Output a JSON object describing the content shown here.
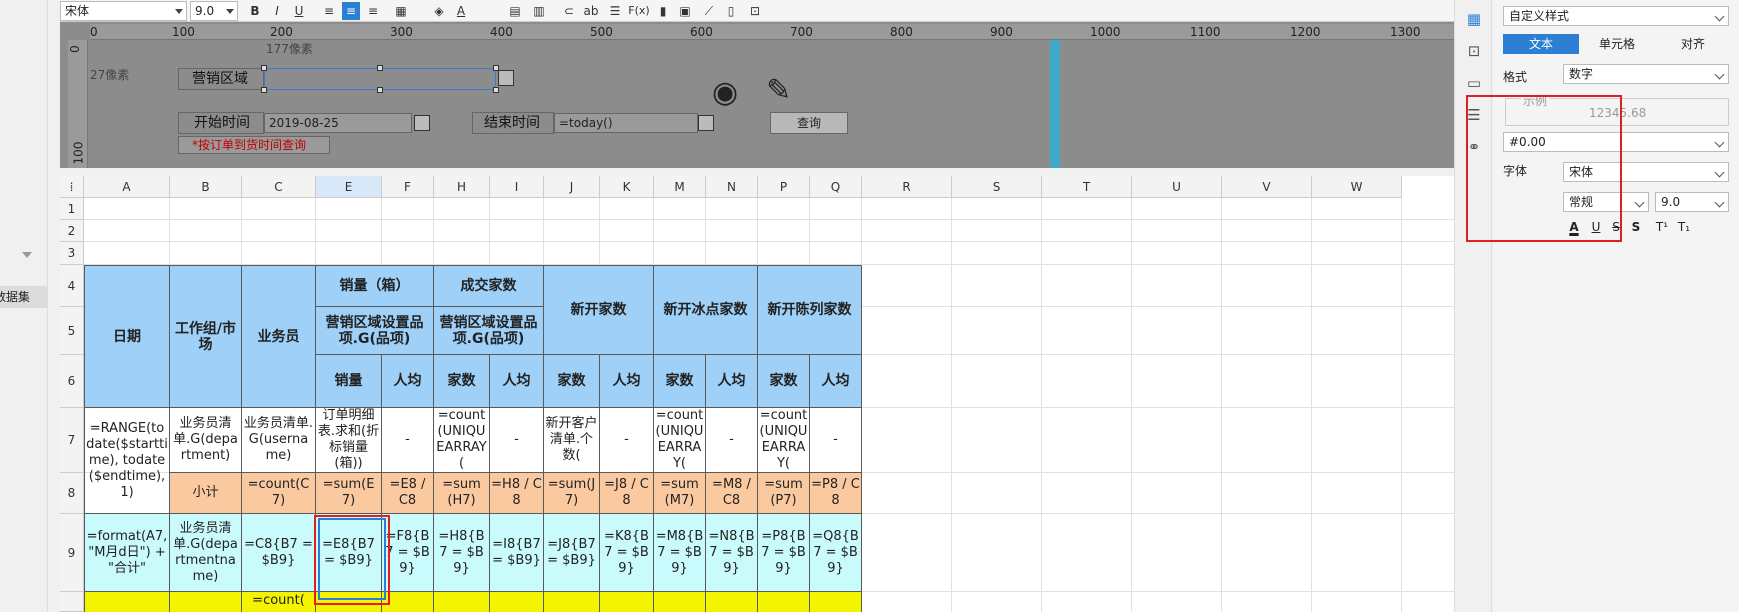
{
  "toolbar": {
    "font": "宋体",
    "size": "9.0",
    "bold": "B",
    "italic": "I",
    "underline": "U",
    "abc": "ab",
    "fx": "F(x)"
  },
  "designer": {
    "ruler_marks": [
      "0",
      "100",
      "200",
      "300",
      "400",
      "500",
      "600",
      "700",
      "800",
      "900",
      "1000",
      "1100",
      "1200",
      "1300"
    ],
    "vruler_marks": [
      "0",
      "100"
    ],
    "width_hint": "177像素",
    "height_hint": "27像素",
    "region_label": "营销区域",
    "start_label": "开始时间",
    "start_value": "2019-08-25",
    "end_label": "结束时间",
    "end_value": "=today()",
    "query_button": "查询",
    "hint_text": "*按订单到货时间查询"
  },
  "grid": {
    "columns": [
      "A",
      "B",
      "C",
      "E",
      "F",
      "H",
      "I",
      "J",
      "K",
      "M",
      "N",
      "P",
      "Q",
      "R",
      "S",
      "T",
      "U",
      "V",
      "W"
    ],
    "rows": [
      "1",
      "2",
      "3",
      "4",
      "5",
      "6",
      "7",
      "8",
      "9"
    ],
    "header": {
      "date": "日期",
      "group": "工作组/市场",
      "salesman": "业务员",
      "volume": "销量（箱）",
      "deal": "成交家数",
      "new": "新开家数",
      "newfrozen": "新开冰点家数",
      "newdisplay": "新开陈列家数",
      "volume_sub": "营销区域设置品项.G(品项)",
      "deal_sub": "营销区域设置品项.G(品项)",
      "xl": "销量",
      "rj": "人均",
      "js": "家数"
    },
    "row7": {
      "a": "=RANGE(todate($starttime), todate($endtime), 1)",
      "b": "业务员清单.G(department)",
      "c": "业务员清单.G(username)",
      "e": "订单明细表.求和(折标销量(箱))",
      "f": "-",
      "h": "=count(UNIQUEARRAY(",
      "i": "-",
      "j": "新开客户清单.个数(",
      "k": "-",
      "m": "=count(UNIQUEARRAY(",
      "n": "-",
      "p": "=count(UNIQUEARRAY(",
      "q": "-"
    },
    "row8": {
      "b": "小计",
      "c": "=count(C7)",
      "e": "=sum(E7)",
      "f": "=E8 / C8",
      "h": "=sum(H7)",
      "i": "=H8 / C8",
      "j": "=sum(J7)",
      "k": "=J8 / C8",
      "m": "=sum(M7)",
      "n": "=M8 / C8",
      "p": "=sum(P7)",
      "q": "=P8 / C8"
    },
    "row9": {
      "a": "=format(A7, \"M月d日\") + \"合计\"",
      "b": "业务员清单.G(departmentname)",
      "c": "=C8{B7 = $B9}",
      "e": "=E8{B7 = $B9}",
      "f": "=F8{B7 = $B9}",
      "h": "=H8{B7 = $B9}",
      "i": "=I8{B7 = $B9}",
      "j": "=J8{B7 = $B9}",
      "k": "=K8{B7 = $B9}",
      "m": "=M8{B7 = $B9}",
      "n": "=N8{B7 = $B9}",
      "p": "=P8{B7 = $B9}",
      "q": "=Q8{B7 = $B9}"
    },
    "row10": {
      "c": "=count("
    }
  },
  "leftpanel": {
    "dataset_label": "数据集"
  },
  "rightpanel": {
    "style_select": "自定义样式",
    "tabs": [
      "文本",
      "单元格",
      "对齐"
    ],
    "format_label": "格式",
    "format_value": "数字",
    "example_label": "示例",
    "example_value": "12345.68",
    "pattern_value": "#0.00",
    "font_label": "字体",
    "font_value": "宋体",
    "style_value": "常规",
    "size_value": "9.0",
    "fontstyle_buttons": [
      "A",
      "U",
      "S",
      "S",
      "T¹",
      "T₁"
    ]
  },
  "colors": {
    "header_blue": "#9ed0f8",
    "subtotal_orange": "#fbc9a0",
    "total_cyan": "#c9fafc",
    "yellow": "#f4f400",
    "tab_active": "#2d7fd3",
    "highlight_red": "#e02020"
  }
}
